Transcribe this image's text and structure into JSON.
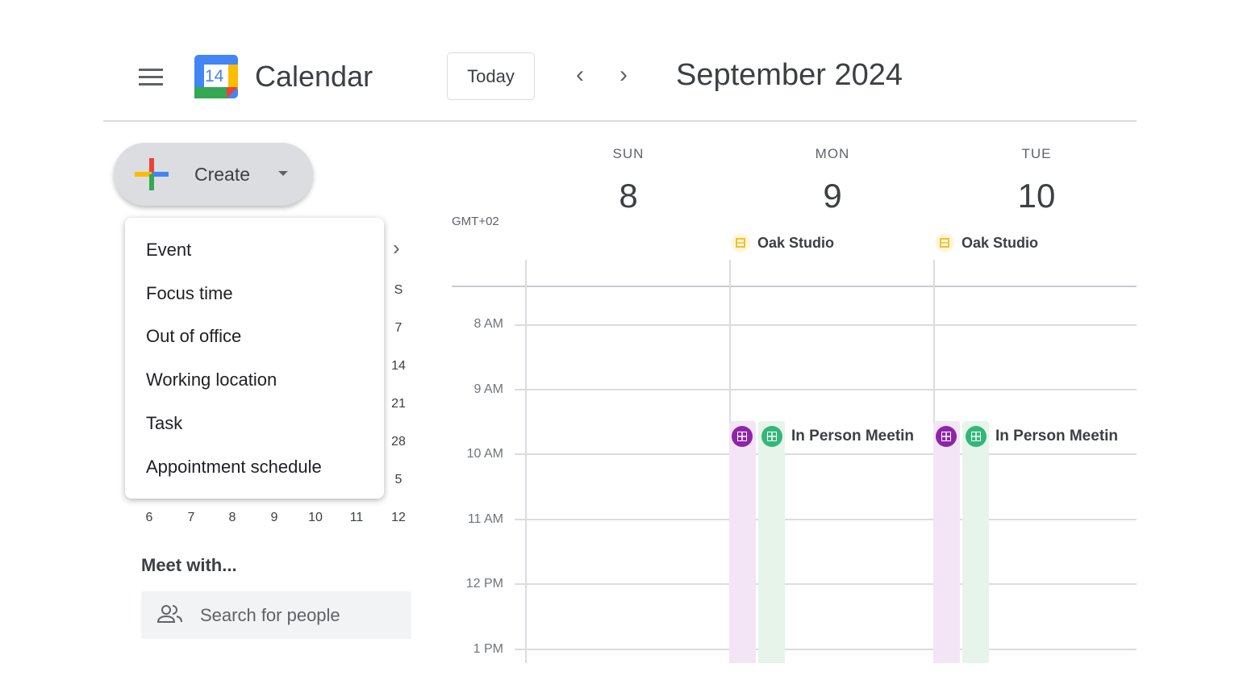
{
  "header": {
    "app_title": "Calendar",
    "logo_day": "14",
    "today_label": "Today",
    "month_label": "September 2024"
  },
  "create": {
    "label": "Create"
  },
  "create_menu": {
    "items": [
      "Event",
      "Focus time",
      "Out of office",
      "Working location",
      "Task",
      "Appointment schedule"
    ]
  },
  "mini_calendar": {
    "right_column": [
      "S",
      "7",
      "14",
      "21",
      "28",
      "5"
    ],
    "bottom_row": [
      "6",
      "7",
      "8",
      "9",
      "10",
      "11",
      "12"
    ]
  },
  "meet_with": {
    "title": "Meet with...",
    "search_placeholder": "Search for people"
  },
  "calendar": {
    "timezone": "GMT+02",
    "days": [
      {
        "dow": "SUN",
        "num": "8"
      },
      {
        "dow": "MON",
        "num": "9"
      },
      {
        "dow": "TUE",
        "num": "10"
      }
    ],
    "working_location": "Oak Studio",
    "times": [
      "8 AM",
      "9 AM",
      "10 AM",
      "11 AM",
      "12 PM",
      "1 PM"
    ],
    "event_title": "In Person Meetin",
    "colors": {
      "purple": "#8e24aa",
      "green": "#33b679",
      "purple_bg": "#f3e5f5",
      "green_bg": "#e6f4ea",
      "location_yellow": "#f6bf26"
    }
  }
}
